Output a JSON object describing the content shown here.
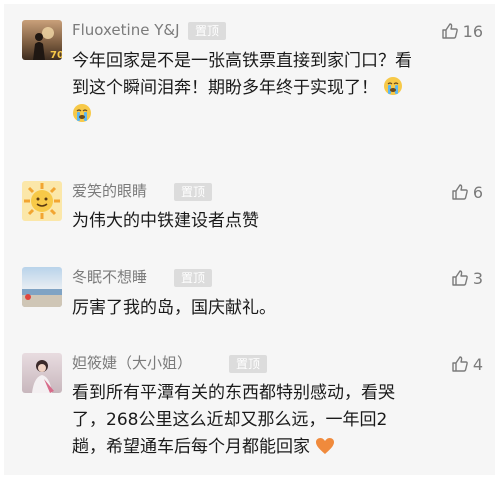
{
  "comments": [
    {
      "nickname": "Fluoxetine Y&J",
      "badge": "置顶",
      "likes": "16",
      "avatar": "silhouette-sunset-avatar",
      "text_line1": "今年回家是不是一张高铁票直接到家门口？看",
      "text_line2": "到这个瞬间泪奔！期盼多年终于实现了！",
      "emoji": "crying-face-emoji"
    },
    {
      "nickname": "爱笑的眼睛",
      "badge": "置顶",
      "likes": "6",
      "avatar": "smiling-sun-avatar",
      "text_line1": "为伟大的中铁建设者点赞"
    },
    {
      "nickname": "冬眠不想睡",
      "badge": "置顶",
      "likes": "3",
      "avatar": "seaside-avatar",
      "text_line1": "厉害了我的岛，国庆献礼。"
    },
    {
      "nickname": "妲筱婕（大小姐）",
      "badge": "置顶",
      "likes": "4",
      "avatar": "portrait-avatar",
      "text_line1": "看到所有平潭有关的东西都特别感动，看哭",
      "text_line2": "了，268公里这么近却又那么远，一年回2",
      "text_line3": "趟，希望通车后每个月都能回家",
      "emoji": "orange-heart-emoji"
    }
  ],
  "colors": {
    "panel_bg": "#f6f6f6",
    "nickname": "#7b7b7b",
    "badge_bg": "#dcdcdc",
    "text": "#1a1a1a",
    "heart": "#f08a3c",
    "emoji_face": "#f7c948"
  }
}
